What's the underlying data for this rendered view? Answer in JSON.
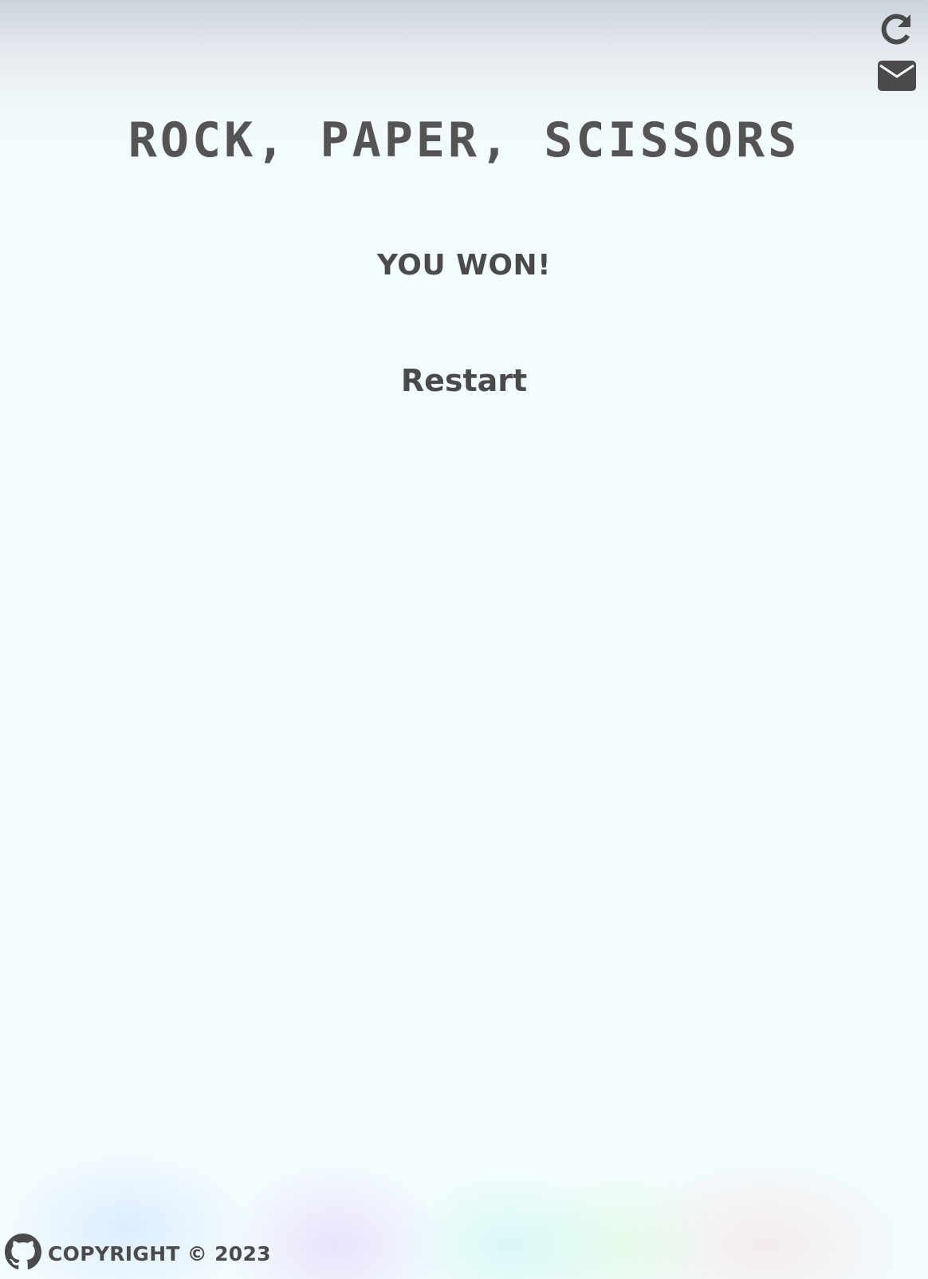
{
  "header": {
    "icons": [
      "refresh-icon",
      "mail-icon"
    ]
  },
  "game": {
    "title": "ROCK, PAPER, SCISSORS",
    "result": "YOU WON!",
    "restart_label": "Restart"
  },
  "footer": {
    "icon": "github-icon",
    "copyright": "COPYRIGHT © 2023"
  },
  "colors": {
    "text": "#4a4a4a",
    "background": "#f3fcfe"
  }
}
